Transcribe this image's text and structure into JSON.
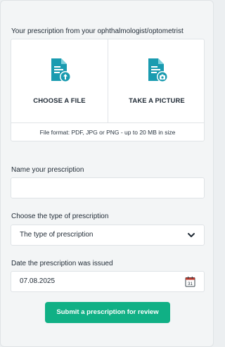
{
  "upload": {
    "section_label": "Your prescription from your ophthalmologist/optometrist",
    "choose_file_label": "CHOOSE A FILE",
    "take_picture_label": "TAKE A PICTURE",
    "format_note": "File format: PDF, JPG or PNG - up to 20 MB in size"
  },
  "name_field": {
    "label": "Name your prescription",
    "value": ""
  },
  "type_field": {
    "label": "Choose the type of prescription",
    "selected": "The type of prescription"
  },
  "date_field": {
    "label": "Date the prescription was issued",
    "value": "07.08.2025",
    "calendar_day": "31"
  },
  "submit": {
    "label": "Submit a prescription for review"
  },
  "colors": {
    "accent": "#10b085",
    "icon": "#1a9bb0"
  },
  "icons": [
    "file-upload-icon",
    "camera-document-icon",
    "chevron-down-icon",
    "calendar-icon"
  ]
}
